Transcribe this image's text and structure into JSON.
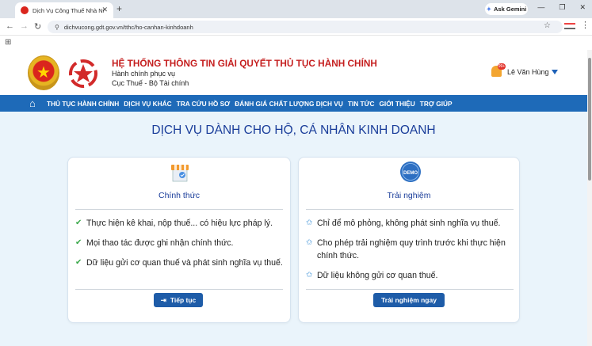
{
  "browser": {
    "tab_title": "Dịch Vụ Công Thuế Nhà Nước",
    "gemini_label": "Ask Gemini",
    "url": "dichvucong.gdt.gov.vn/tthc/ho-canhan-kinhdoanh"
  },
  "header": {
    "title": "HỆ THỐNG THÔNG TIN GIẢI QUYẾT THỦ TỤC HÀNH CHÍNH",
    "subtitle1": "Hành chính phục vụ",
    "subtitle2": "Cục Thuế - Bộ Tài chính",
    "user_name": "Lê Văn Hùng",
    "badge_text": "99+"
  },
  "nav": {
    "items": [
      "THỦ TỤC HÀNH CHÍNH",
      "DỊCH VỤ KHÁC",
      "TRA CỨU HỒ SƠ",
      "ĐÁNH GIÁ CHẤT LƯỢNG DỊCH VỤ",
      "TIN TỨC",
      "GIỚI THIỆU",
      "TRỢ GIÚP"
    ]
  },
  "main": {
    "title": "DỊCH VỤ DÀNH CHO HỘ, CÁ NHÂN KINH DOANH",
    "official": {
      "title": "Chính thức",
      "items": [
        "Thực hiện kê khai, nộp thuế... có hiệu lực pháp lý.",
        "Mọi thao tác được ghi nhận chính thức.",
        "Dữ liệu gửi cơ quan thuế và phát sinh nghĩa vụ thuế."
      ],
      "button": "Tiếp tục"
    },
    "demo": {
      "title": "Trải nghiệm",
      "icon_label": "DEMO",
      "items": [
        "Chỉ để mô phỏng, không phát sinh nghĩa vụ thuế.",
        "Cho phép trải nghiệm quy trình trước khi thực hiện chính thức.",
        "Dữ liệu không gửi cơ quan thuế."
      ],
      "button": "Trải nghiệm ngay"
    }
  },
  "colors": {
    "nav_bg": "#1e6ab8",
    "title_red": "#c51f1f",
    "heading_blue": "#1a3d9a",
    "button_blue": "#1e5ca8",
    "page_bg": "#eaf4fb"
  }
}
